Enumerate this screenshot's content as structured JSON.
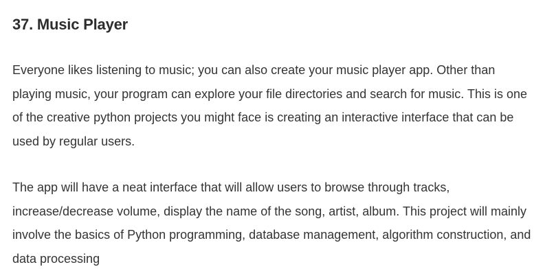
{
  "section": {
    "heading": "37. Music Player",
    "paragraphs": [
      "Everyone likes listening to music; you can also create your music player app. Other than playing music, your program can explore your file directories and search for music. This is one of the creative python projects you might face is creating an interactive interface that can be used by regular users.",
      "The app will have a neat interface that will allow users to browse through tracks, increase/decrease volume, display the name of the song, artist, album. This project will mainly involve the basics of Python programming, database management, algorithm construction, and data processing"
    ]
  }
}
